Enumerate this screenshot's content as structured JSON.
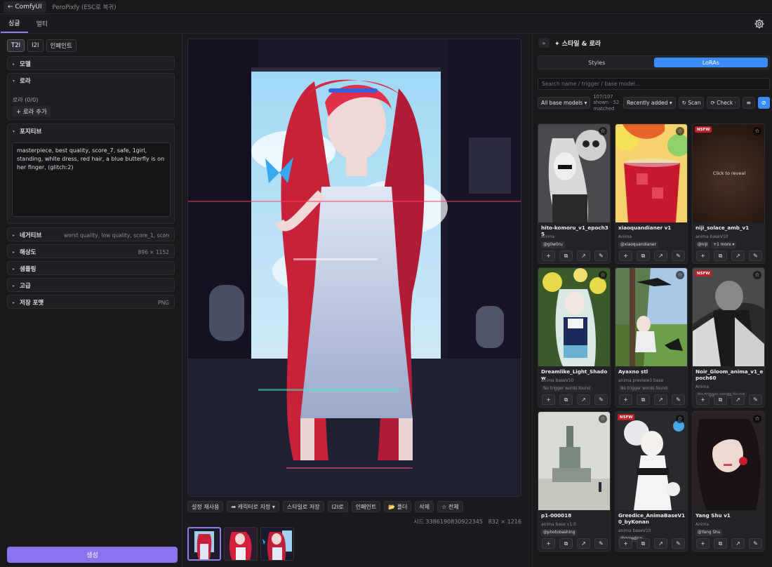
{
  "topbar": {
    "back_label": "← ComfyUI",
    "subtitle": "PeroPixfy (ESC로 복귀)"
  },
  "tabs": [
    {
      "label": "싱글",
      "active": true
    },
    {
      "label": "멀티",
      "active": false
    }
  ],
  "left": {
    "modes": [
      "T2I",
      "I2I",
      "인페인트"
    ],
    "model": {
      "label": "모델"
    },
    "lora": {
      "label": "로라",
      "count": "로라 (0/0)",
      "add": "+ 로라 추가"
    },
    "positive": {
      "label": "포지티브",
      "text": "masterpiece, best quality, score_7, safe, 1girl, standing, white dress, red hair, a blue butterfly is on her finger, (glitch:2)"
    },
    "negative": {
      "label": "네거티브",
      "value": "worst quality, low quality, score_1, score_2, sc..."
    },
    "resolution": {
      "label": "해상도",
      "value": "896 × 1152"
    },
    "sampling": {
      "label": "샘플링"
    },
    "advanced": {
      "label": "고급"
    },
    "save_format": {
      "label": "저장 포맷",
      "value": "PNG"
    },
    "generate": "생성"
  },
  "center": {
    "actions": [
      "설정 재사용",
      "➡ 캐릭터로 지정 ▾",
      "스타일로 저장",
      "I2I로",
      "인페인트",
      "📂 폴더",
      "삭제",
      "☆ 전체"
    ],
    "seed": "시드 3386190830922345",
    "size": "832 × 1216"
  },
  "right": {
    "title": "✦ 스타일 & 로라",
    "collapse": "»",
    "toggle": [
      "Styles",
      "LoRAs"
    ],
    "search_placeholder": "Search name / trigger / base model...",
    "filter_base": "All base models ▾",
    "count_text": "107/107 shown · 52 matched",
    "sort": "Recently added ▾",
    "scan": "↻ Scan",
    "check": "⟳ Check ·"
  },
  "cards": [
    {
      "title": "hito-komoru_v1_epoch35",
      "base": "Anima",
      "tags": [
        "@g0w0ru"
      ],
      "nsfw": false
    },
    {
      "title": "xiaoquandianer v1",
      "base": "Anima",
      "tags": [
        "@xiaoquandianer"
      ],
      "nsfw": false
    },
    {
      "title": "niji_solace_amb_v1",
      "base": "anima baseV10",
      "tags": [
        "@niji",
        "+1 more ▾"
      ],
      "nsfw": true,
      "reveal": "Click to reveal"
    },
    {
      "title": "Dreamlike_Light_Shadow",
      "base": "anima baseV10",
      "notrig": "No trigger words found",
      "nsfw": false
    },
    {
      "title": "Ayaxno stl",
      "base": "anima preview3 base",
      "notrig": "No trigger words found",
      "nsfw": false
    },
    {
      "title": "Noir_Gloom_anima_v1_epoch60",
      "base": "Anima",
      "notrig": "No trigger words found",
      "nsfw": true
    },
    {
      "title": "p1-000018",
      "base": "anima base v1.0",
      "tags": [
        "@photobashing"
      ],
      "nsfw": false
    },
    {
      "title": "Greedice_AnimaBaseV10_byKonan",
      "base": "anima baseV10",
      "tags": [
        "@greedice"
      ],
      "nsfw": true
    },
    {
      "title": "Yang Shu v1",
      "base": "Anima",
      "tags": [
        "@Yang Shu"
      ],
      "nsfw": false
    }
  ],
  "nsfw_label": "NSFW",
  "colors": {
    "accent": "#8b7cf6",
    "blue": "#3b8cf6",
    "nsfw": "#c01e2b"
  }
}
